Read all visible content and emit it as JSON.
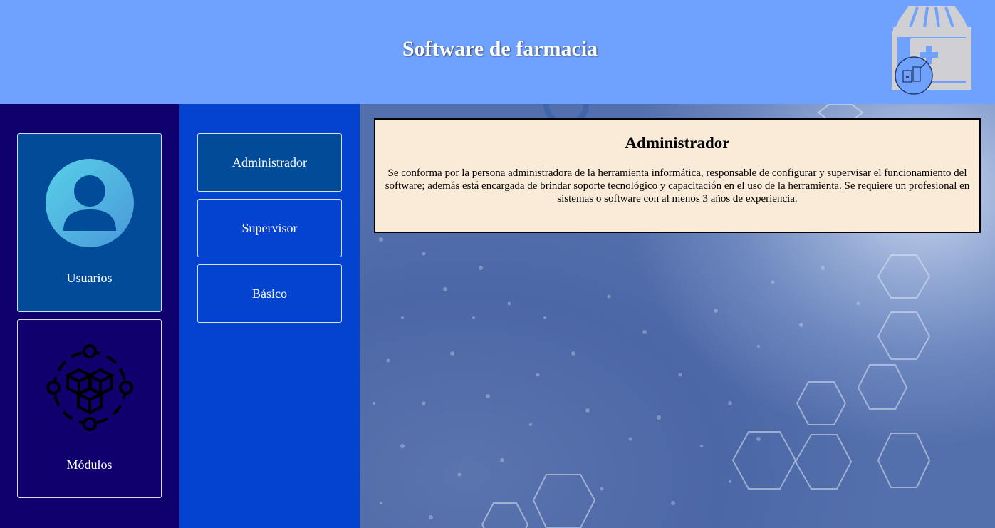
{
  "header": {
    "title": "Software de farmacia",
    "logo_icon": "pharmacy-store-icon"
  },
  "sidebar": {
    "cards": [
      {
        "label": "Usuarios",
        "icon": "user-avatar-icon"
      },
      {
        "label": "Módulos",
        "icon": "modules-cubes-icon"
      }
    ]
  },
  "roles": [
    {
      "label": "Administrador",
      "selected": true
    },
    {
      "label": "Supervisor",
      "selected": false
    },
    {
      "label": "Básico",
      "selected": false
    }
  ],
  "detail": {
    "title": "Administrador",
    "text": "Se conforma por la persona administradora de la herramienta informática, responsable de configurar y supervisar el funcionamiento del software; además está encargada de brindar soporte tecnológico y capacitación en el uso de la herramienta. Se requiere un profesional en sistemas o software con al menos 3 años de experiencia."
  },
  "colors": {
    "header_bg": "#6ea2fe",
    "sidebar_bg": "#10006e",
    "roles_bg": "#0442d0",
    "selected_bg": "#024b99",
    "detail_bg": "#faebd8"
  }
}
